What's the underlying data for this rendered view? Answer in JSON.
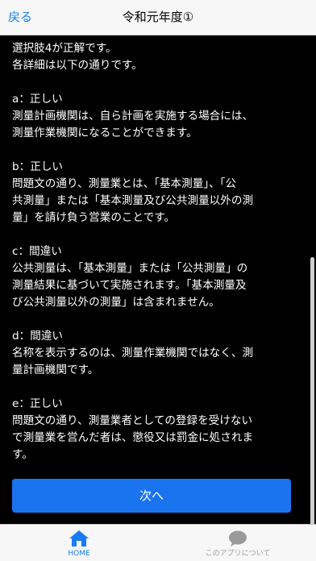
{
  "navbar": {
    "back_label": "戻る",
    "title": "令和元年度①"
  },
  "content": {
    "intro": [
      "選択肢4が正解です。",
      "各詳細は以下の通りです。"
    ],
    "items": [
      {
        "heading": "a：正しい",
        "lines": [
          "測量計画機関は、自ら計画を実施する場合には、",
          "測量作業機関になることができます。"
        ]
      },
      {
        "heading": "b：正しい",
        "lines": [
          "問題文の通り、測量業とは、「基本測量」、「公",
          "共測量」または「基本測量及び公共測量以外の測",
          "量」を請け負う営業のことです。"
        ]
      },
      {
        "heading": "c：間違い",
        "lines": [
          "公共測量は、「基本測量」または「公共測量」の",
          "測量結果に基づいて実施されます。「基本測量及",
          "び公共測量以外の測量」は含まれません。"
        ]
      },
      {
        "heading": "d：間違い",
        "lines": [
          "名称を表示するのは、測量作業機関ではなく、測",
          "量計画機関です。"
        ]
      },
      {
        "heading": "e：正しい",
        "lines": [
          "問題文の通り、測量業者としての登録を受けない",
          "で測量業を営んだ者は、懲役又は罰金に処されま",
          "す。"
        ]
      }
    ]
  },
  "next_button": {
    "label": "次へ"
  },
  "tabbar": {
    "home": {
      "label": "HOME",
      "icon": "home-icon",
      "color": "#1a7cf5"
    },
    "about": {
      "label": "このアプリについて",
      "icon": "chat-bubble-icon",
      "color": "#9a9a9a"
    }
  }
}
